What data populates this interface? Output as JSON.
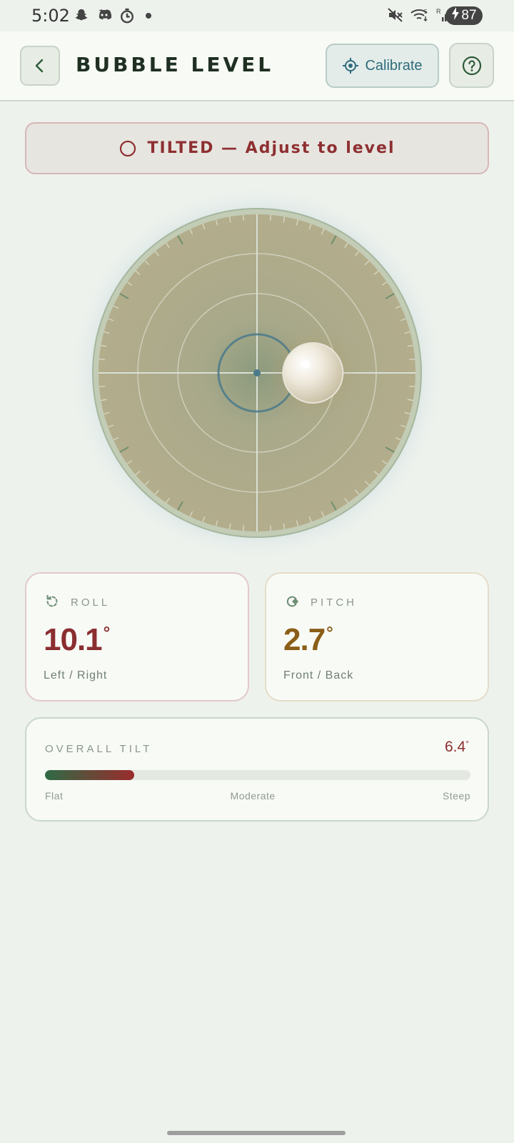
{
  "status_bar": {
    "time": "5:02",
    "battery": "87",
    "left_icons": [
      "snapchat-icon",
      "discord-icon",
      "timer-icon"
    ],
    "right_icons": [
      "mute-icon",
      "wifi-icon",
      "signal-r-icon",
      "signal-icon"
    ]
  },
  "header": {
    "title": "BUBBLE LEVEL",
    "calibrate_label": "Calibrate"
  },
  "banner": {
    "text": "TILTED — Adjust to level",
    "color": "#8e2f31"
  },
  "dial": {
    "bubble_x_deg": 2.7,
    "bubble_y_deg": 0.0,
    "colors": {
      "face": "#aea98a",
      "rim": "#c3ccb5",
      "accent": "#4a7a8c"
    }
  },
  "roll": {
    "label": "ROLL",
    "value": "10.1",
    "unit": "°",
    "sub": "Left / Right",
    "color": "#8b2e30"
  },
  "pitch": {
    "label": "PITCH",
    "value": "2.7",
    "unit": "°",
    "sub": "Front / Back",
    "color": "#8a5e18"
  },
  "overall": {
    "label": "OVERALL TILT",
    "value": "6.4",
    "unit": "°",
    "fill_fraction": 0.21,
    "scale": [
      "Flat",
      "Moderate",
      "Steep"
    ]
  }
}
